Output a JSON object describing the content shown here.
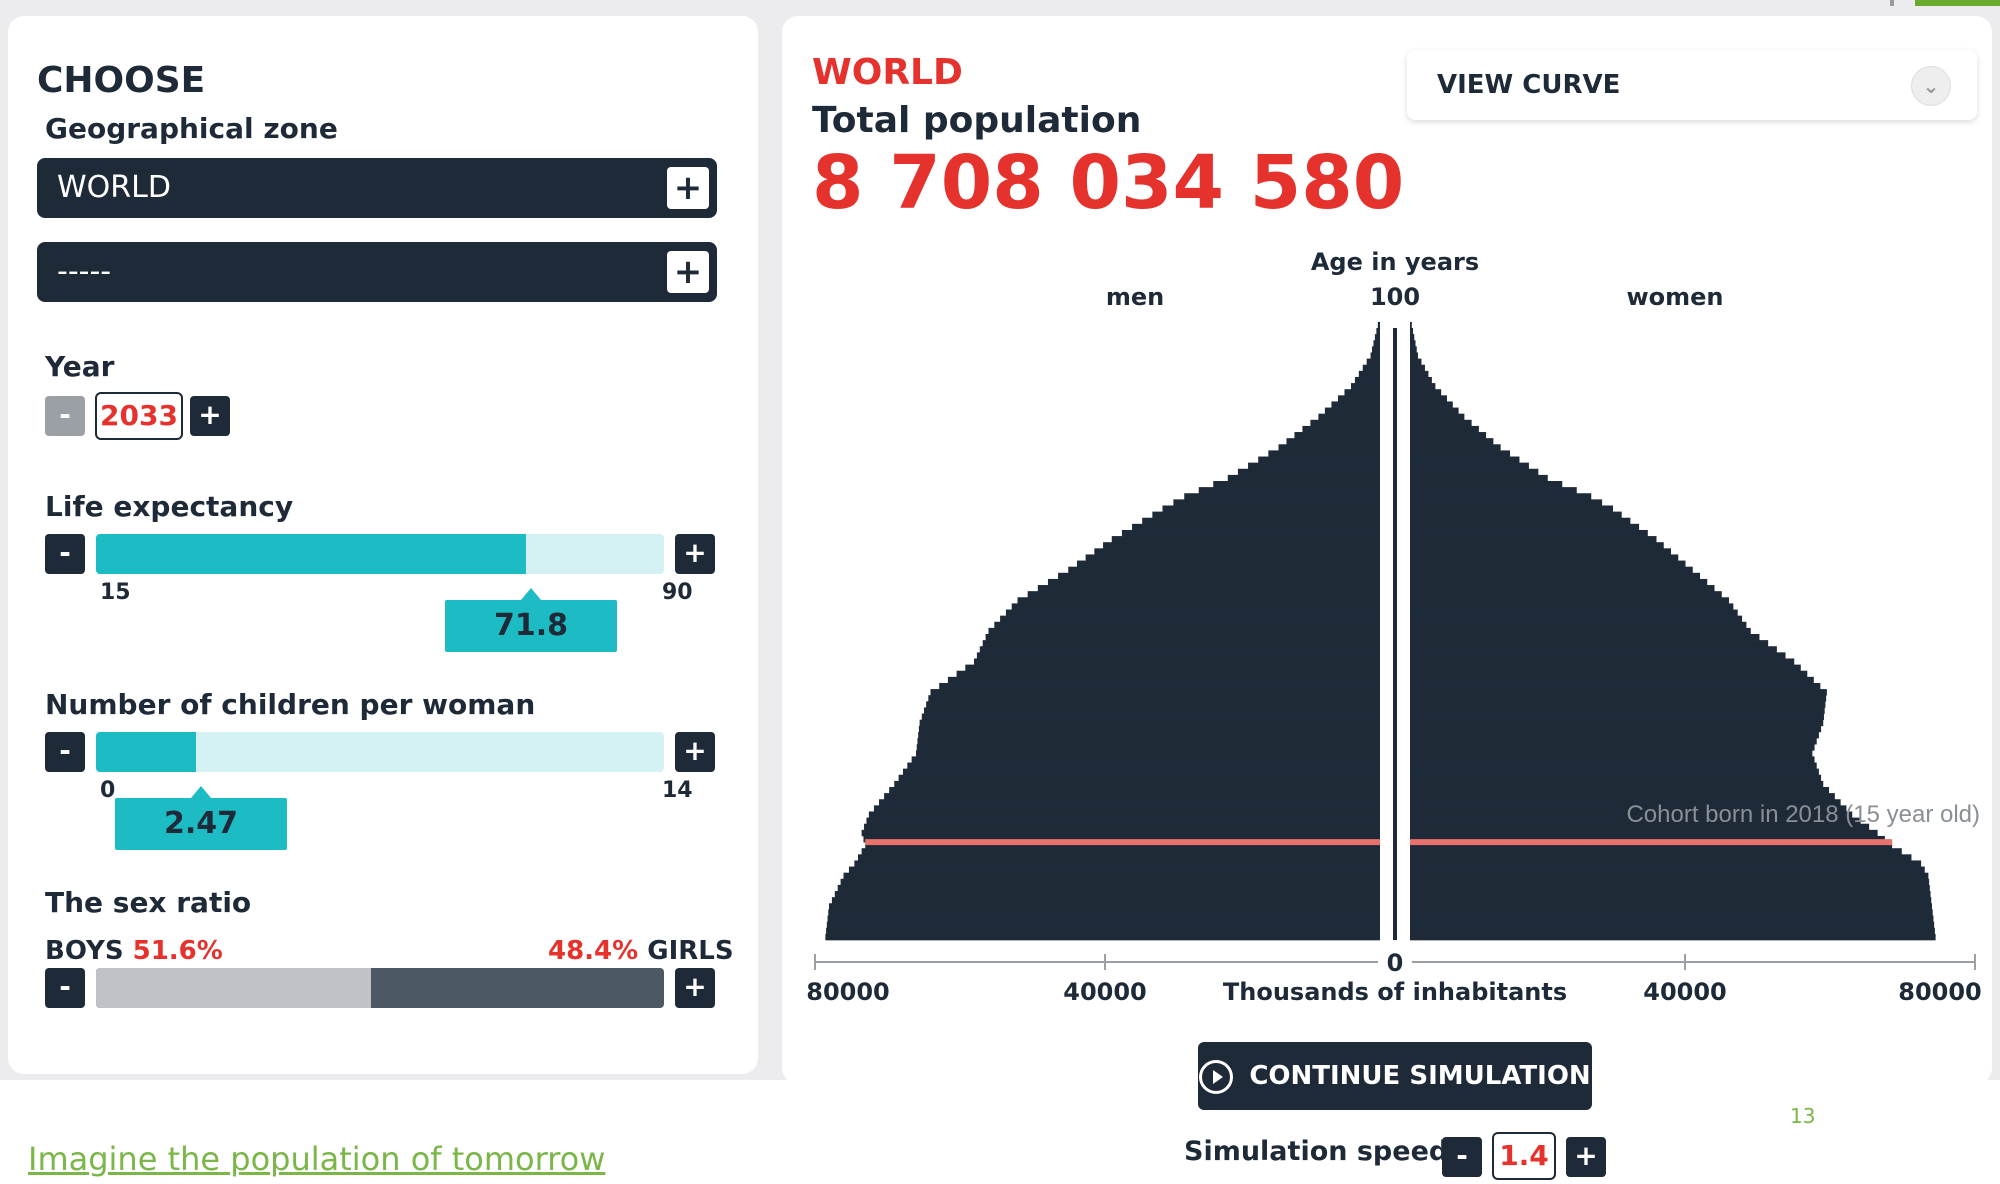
{
  "left": {
    "choose_title": "CHOOSE",
    "zone_label": "Geographical zone",
    "zone1": "WORLD",
    "zone2": "-----",
    "plus": "+",
    "minus": "-",
    "year_label": "Year",
    "year_value": "2033",
    "life": {
      "label": "Life expectancy",
      "min": "15",
      "max": "90",
      "value": "71.8"
    },
    "children": {
      "label": "Number of children per woman",
      "min": "0",
      "max": "14",
      "value": "2.47"
    },
    "sex": {
      "label": "The sex ratio",
      "boys_label": "BOYS",
      "boys_pct": "51.6%",
      "girls_pct": "48.4%",
      "girls_label": "GIRLS"
    }
  },
  "right": {
    "region": "WORLD",
    "total_label": "Total population",
    "total_value": "8 708 034 580",
    "view_curve": "VIEW CURVE",
    "continue": "CONTINUE SIMULATION",
    "speed_label": "Simulation speed",
    "speed_value": "1.4"
  },
  "chart_data": {
    "type": "bar",
    "title": "Age in years",
    "left_label": "men",
    "right_label": "women",
    "top_age_label": "100",
    "xlabel": "Thousands of inhabitants",
    "xticks_left": [
      "80000",
      "40000"
    ],
    "xticks_right": [
      "40000",
      "80000"
    ],
    "zero_label": "0",
    "xlim": [
      0,
      80000
    ],
    "age_range": [
      0,
      100
    ],
    "cohort_text": "Cohort born in 2018 (15 year old)",
    "cohort_age": 15,
    "colors": {
      "bars": "#1e2a37",
      "cohort_line": "#e8716b"
    },
    "ages": [
      0,
      5,
      10,
      12,
      15,
      17,
      20,
      25,
      30,
      35,
      40,
      45,
      50,
      55,
      60,
      65,
      70,
      72,
      75,
      80,
      85,
      90,
      95,
      100
    ],
    "men": [
      76500,
      76000,
      74000,
      72500,
      71000,
      71500,
      70500,
      67000,
      64000,
      63500,
      62000,
      56000,
      54000,
      50000,
      43000,
      37000,
      30000,
      27000,
      21000,
      14000,
      8500,
      4000,
      1300,
      300
    ],
    "women": [
      72500,
      72000,
      71500,
      70500,
      66500,
      64500,
      61000,
      57000,
      55500,
      57000,
      57500,
      53000,
      47000,
      44000,
      39000,
      34000,
      28000,
      25000,
      19000,
      12500,
      7500,
      3500,
      1100,
      250
    ]
  },
  "footer": {
    "link": "Imagine the population of tomorrow",
    "page": "13"
  }
}
